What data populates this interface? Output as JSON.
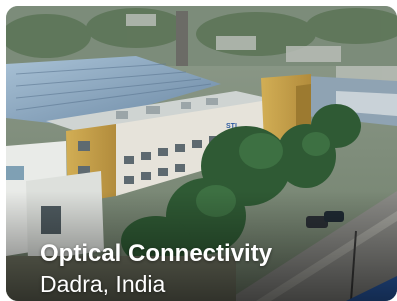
{
  "card": {
    "title": "Optical Connectivity",
    "location": "Dadra, India",
    "sign_text": "STL"
  },
  "colors": {
    "title_text": "#ffffff",
    "building_wall": "#c8a24a",
    "roof": "#7f9cb8",
    "trees": "#2f5a34",
    "road": "#8a8a86"
  },
  "image": {
    "subject": "aerial-view-factory-campus"
  }
}
